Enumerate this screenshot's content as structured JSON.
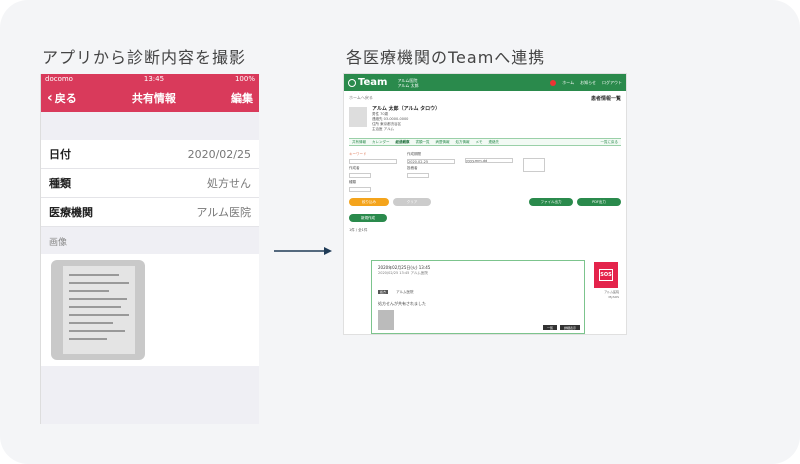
{
  "captions": {
    "left": "アプリから診断内容を撮影",
    "right": "各医療機関のTeamへ連携"
  },
  "phone": {
    "status": {
      "carrier": "docomo",
      "time": "13:45",
      "battery": "100%"
    },
    "nav": {
      "back": "戻る",
      "title": "共有情報",
      "edit": "編集"
    },
    "rows": [
      {
        "label": "日付",
        "value": "2020/02/25"
      },
      {
        "label": "種類",
        "value": "処方せん"
      },
      {
        "label": "医療機関",
        "value": "アルム医院"
      }
    ],
    "image_section": "画像"
  },
  "web": {
    "logo": "Team",
    "header_sub_1": "アルム医院",
    "header_sub_2": "アルム 太郎",
    "header_links": [
      "ホーム",
      "お知らせ",
      "ログアウト"
    ],
    "crumb": "ホームへ戻る",
    "crumb_right": "患者情報一覧",
    "patient": {
      "name": "アルム 太郎（アルム タロウ）",
      "lines": [
        "男性 70歳",
        "連絡先 03-0000-0000",
        "住所 東京都渋谷区",
        "主治医 アルム"
      ]
    },
    "tabs": [
      "共有情報",
      "カレンダー",
      "経過観察",
      "書類一覧",
      "病歴情報",
      "処方情報",
      "メモ",
      "連絡先"
    ],
    "tab_active_index": 2,
    "tab_right": "一覧に戻る",
    "filter": {
      "label_1": "キーワード",
      "label_2": "作成期間",
      "date_from": "2020.02.25",
      "date_to": "yyyy.mm.dd",
      "label_3": "作成者",
      "label_4": "投稿者",
      "label_5": "種類"
    },
    "buttons": {
      "search": "絞り込み",
      "clear": "クリア",
      "export_1": "ファイル出力",
      "export_2": "PDF出力",
      "new": "新規作成"
    },
    "count": "1件 / 全1件",
    "card": {
      "date": "2020年02月25日(火) 13:45",
      "sub": "2020/02/25 13:45 アルム医院",
      "tag": "処方",
      "tag_text": "アルム医院",
      "text": "処方せんが共有されました",
      "btn_1": "一覧",
      "btn_2": "詳細表示"
    },
    "sos": {
      "icon": "SOS",
      "label_1": "アルム医院",
      "label_2": "MySOS"
    }
  },
  "colors": {
    "phone_nav": "#d93a5b",
    "team_green": "#2a8a4c",
    "sos_red": "#e4234b"
  }
}
